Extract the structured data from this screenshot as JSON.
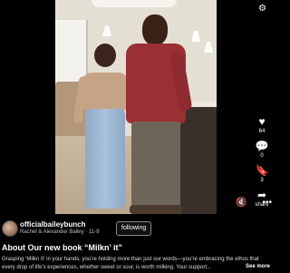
{
  "post": {
    "photo_alt": "photo"
  },
  "rail": [
    {
      "icon": "heart-icon",
      "glyph": "♥",
      "count": "64"
    },
    {
      "icon": "comment-icon",
      "glyph": "💬",
      "count": "0"
    },
    {
      "icon": "bookmark-icon",
      "glyph": "🔖",
      "count": "3"
    },
    {
      "icon": "share-icon",
      "glyph": "➦",
      "count": "share"
    }
  ],
  "top_control": "⚙",
  "controls": {
    "more": "•••",
    "volume": "🔇"
  },
  "account": {
    "name": "officialbaileybunch",
    "subtitle": "Rachel & Alexander Bailey · 11-8",
    "follow_label": "following"
  },
  "caption": {
    "title": "About Our new book “Milkn’ it”",
    "body": "Grasping ‘Milkn It’ in your hands, you’re holding more than just our words—you’re embracing the ethos that every drop of life’s experiences, whether sweet or sour, is worth milking. Your support...",
    "see_more": "See more"
  },
  "colors": {
    "background": "#000000",
    "shirt": "#9a2f34"
  }
}
